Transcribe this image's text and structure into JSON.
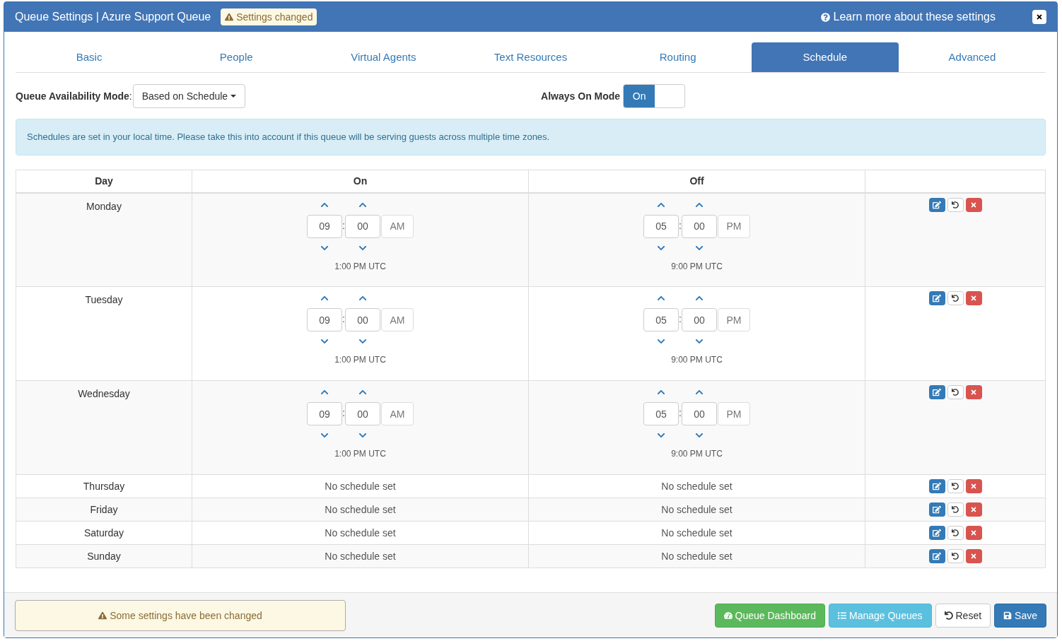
{
  "window": {
    "title": "Queue Settings | Azure Support Queue",
    "badge": "Settings changed",
    "help_link": "Learn more about these settings"
  },
  "tabs": [
    {
      "label": "Basic",
      "selected": false
    },
    {
      "label": "People",
      "selected": false
    },
    {
      "label": "Virtual Agents",
      "selected": false
    },
    {
      "label": "Text Resources",
      "selected": false
    },
    {
      "label": "Routing",
      "selected": false
    },
    {
      "label": "Schedule",
      "selected": true
    },
    {
      "label": "Advanced",
      "selected": false
    }
  ],
  "availability": {
    "label": "Queue Availability Mode",
    "separator": ":",
    "value": "Based on Schedule"
  },
  "always_on": {
    "label": "Always On Mode",
    "toggle_label": "On",
    "on": true
  },
  "info": "Schedules are set in your local time. Please take this into account if this queue will be serving guests across multiple time zones.",
  "table": {
    "columns": [
      "Day",
      "On",
      "Off"
    ],
    "rows": [
      {
        "kind": "schedule",
        "day": "Monday",
        "on": {
          "hour": "09",
          "separator": ":",
          "minute": "00",
          "period": "AM",
          "utc": "1:00 PM UTC"
        },
        "off": {
          "hour": "05",
          "separator": ":",
          "minute": "00",
          "period": "PM",
          "utc": "9:00 PM UTC"
        }
      },
      {
        "kind": "schedule",
        "day": "Tuesday",
        "on": {
          "hour": "09",
          "separator": ":",
          "minute": "00",
          "period": "AM",
          "utc": "1:00 PM UTC"
        },
        "off": {
          "hour": "05",
          "separator": ":",
          "minute": "00",
          "period": "PM",
          "utc": "9:00 PM UTC"
        }
      },
      {
        "kind": "schedule",
        "day": "Wednesday",
        "on": {
          "hour": "09",
          "separator": ":",
          "minute": "00",
          "period": "AM",
          "utc": "1:00 PM UTC"
        },
        "off": {
          "hour": "05",
          "separator": ":",
          "minute": "00",
          "period": "PM",
          "utc": "9:00 PM UTC"
        }
      },
      {
        "kind": "empty",
        "day": "Thursday",
        "on_text": "No schedule set",
        "off_text": "No schedule set"
      },
      {
        "kind": "empty",
        "day": "Friday",
        "on_text": "No schedule set",
        "off_text": "No schedule set"
      },
      {
        "kind": "empty",
        "day": "Saturday",
        "on_text": "No schedule set",
        "off_text": "No schedule set"
      },
      {
        "kind": "empty",
        "day": "Sunday",
        "on_text": "No schedule set",
        "off_text": "No schedule set"
      }
    ]
  },
  "footer": {
    "warning": "Some settings have been changed",
    "buttons": [
      {
        "kind": "dashboard",
        "label": "Queue Dashboard"
      },
      {
        "kind": "manage",
        "label": "Manage Queues"
      },
      {
        "kind": "reset",
        "label": "Reset"
      },
      {
        "kind": "save",
        "label": "Save"
      }
    ]
  }
}
